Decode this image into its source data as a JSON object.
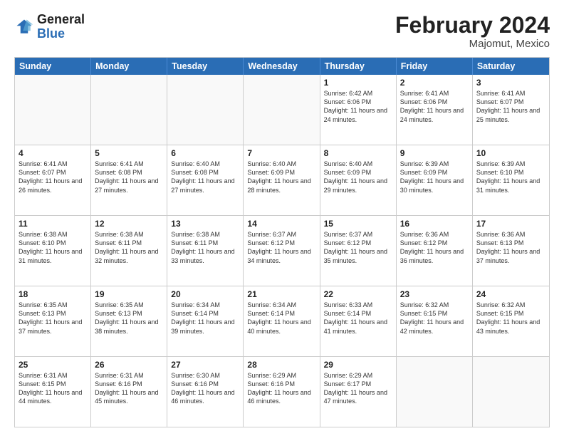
{
  "header": {
    "logo_general": "General",
    "logo_blue": "Blue",
    "title": "February 2024",
    "location": "Majomut, Mexico"
  },
  "days_of_week": [
    "Sunday",
    "Monday",
    "Tuesday",
    "Wednesday",
    "Thursday",
    "Friday",
    "Saturday"
  ],
  "weeks": [
    [
      {
        "day": "",
        "info": ""
      },
      {
        "day": "",
        "info": ""
      },
      {
        "day": "",
        "info": ""
      },
      {
        "day": "",
        "info": ""
      },
      {
        "day": "1",
        "info": "Sunrise: 6:42 AM\nSunset: 6:06 PM\nDaylight: 11 hours and 24 minutes."
      },
      {
        "day": "2",
        "info": "Sunrise: 6:41 AM\nSunset: 6:06 PM\nDaylight: 11 hours and 24 minutes."
      },
      {
        "day": "3",
        "info": "Sunrise: 6:41 AM\nSunset: 6:07 PM\nDaylight: 11 hours and 25 minutes."
      }
    ],
    [
      {
        "day": "4",
        "info": "Sunrise: 6:41 AM\nSunset: 6:07 PM\nDaylight: 11 hours and 26 minutes."
      },
      {
        "day": "5",
        "info": "Sunrise: 6:41 AM\nSunset: 6:08 PM\nDaylight: 11 hours and 27 minutes."
      },
      {
        "day": "6",
        "info": "Sunrise: 6:40 AM\nSunset: 6:08 PM\nDaylight: 11 hours and 27 minutes."
      },
      {
        "day": "7",
        "info": "Sunrise: 6:40 AM\nSunset: 6:09 PM\nDaylight: 11 hours and 28 minutes."
      },
      {
        "day": "8",
        "info": "Sunrise: 6:40 AM\nSunset: 6:09 PM\nDaylight: 11 hours and 29 minutes."
      },
      {
        "day": "9",
        "info": "Sunrise: 6:39 AM\nSunset: 6:09 PM\nDaylight: 11 hours and 30 minutes."
      },
      {
        "day": "10",
        "info": "Sunrise: 6:39 AM\nSunset: 6:10 PM\nDaylight: 11 hours and 31 minutes."
      }
    ],
    [
      {
        "day": "11",
        "info": "Sunrise: 6:38 AM\nSunset: 6:10 PM\nDaylight: 11 hours and 31 minutes."
      },
      {
        "day": "12",
        "info": "Sunrise: 6:38 AM\nSunset: 6:11 PM\nDaylight: 11 hours and 32 minutes."
      },
      {
        "day": "13",
        "info": "Sunrise: 6:38 AM\nSunset: 6:11 PM\nDaylight: 11 hours and 33 minutes."
      },
      {
        "day": "14",
        "info": "Sunrise: 6:37 AM\nSunset: 6:12 PM\nDaylight: 11 hours and 34 minutes."
      },
      {
        "day": "15",
        "info": "Sunrise: 6:37 AM\nSunset: 6:12 PM\nDaylight: 11 hours and 35 minutes."
      },
      {
        "day": "16",
        "info": "Sunrise: 6:36 AM\nSunset: 6:12 PM\nDaylight: 11 hours and 36 minutes."
      },
      {
        "day": "17",
        "info": "Sunrise: 6:36 AM\nSunset: 6:13 PM\nDaylight: 11 hours and 37 minutes."
      }
    ],
    [
      {
        "day": "18",
        "info": "Sunrise: 6:35 AM\nSunset: 6:13 PM\nDaylight: 11 hours and 37 minutes."
      },
      {
        "day": "19",
        "info": "Sunrise: 6:35 AM\nSunset: 6:13 PM\nDaylight: 11 hours and 38 minutes."
      },
      {
        "day": "20",
        "info": "Sunrise: 6:34 AM\nSunset: 6:14 PM\nDaylight: 11 hours and 39 minutes."
      },
      {
        "day": "21",
        "info": "Sunrise: 6:34 AM\nSunset: 6:14 PM\nDaylight: 11 hours and 40 minutes."
      },
      {
        "day": "22",
        "info": "Sunrise: 6:33 AM\nSunset: 6:14 PM\nDaylight: 11 hours and 41 minutes."
      },
      {
        "day": "23",
        "info": "Sunrise: 6:32 AM\nSunset: 6:15 PM\nDaylight: 11 hours and 42 minutes."
      },
      {
        "day": "24",
        "info": "Sunrise: 6:32 AM\nSunset: 6:15 PM\nDaylight: 11 hours and 43 minutes."
      }
    ],
    [
      {
        "day": "25",
        "info": "Sunrise: 6:31 AM\nSunset: 6:15 PM\nDaylight: 11 hours and 44 minutes."
      },
      {
        "day": "26",
        "info": "Sunrise: 6:31 AM\nSunset: 6:16 PM\nDaylight: 11 hours and 45 minutes."
      },
      {
        "day": "27",
        "info": "Sunrise: 6:30 AM\nSunset: 6:16 PM\nDaylight: 11 hours and 46 minutes."
      },
      {
        "day": "28",
        "info": "Sunrise: 6:29 AM\nSunset: 6:16 PM\nDaylight: 11 hours and 46 minutes."
      },
      {
        "day": "29",
        "info": "Sunrise: 6:29 AM\nSunset: 6:17 PM\nDaylight: 11 hours and 47 minutes."
      },
      {
        "day": "",
        "info": ""
      },
      {
        "day": "",
        "info": ""
      }
    ]
  ]
}
